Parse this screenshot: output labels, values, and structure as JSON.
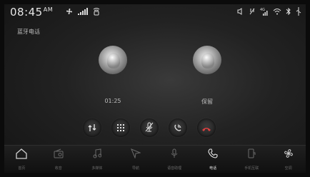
{
  "status_bar": {
    "time": "08:45",
    "ampm": "AM",
    "left_icons": [
      "fan-icon",
      "signal-icon",
      "wireless-charging-icon"
    ],
    "right_icons": [
      "volume-icon",
      "mute-icon",
      "4g-signal-icon",
      "wifi-icon",
      "bluetooth-icon",
      "usb-icon"
    ]
  },
  "page": {
    "title": "蓝牙电话"
  },
  "calls": [
    {
      "state": "01:25",
      "role": "active"
    },
    {
      "state": "保留",
      "role": "held"
    }
  ],
  "controls": [
    {
      "icon": "swap-calls-icon"
    },
    {
      "icon": "keypad-icon"
    },
    {
      "icon": "mute-mic-icon"
    },
    {
      "icon": "earpiece-icon"
    },
    {
      "icon": "hang-up-icon"
    }
  ],
  "bottom_nav": {
    "home_label": "首页",
    "items": [
      {
        "label": "收音",
        "icon": "radio-icon"
      },
      {
        "label": "多媒体",
        "icon": "music-icon"
      },
      {
        "label": "导航",
        "icon": "navigation-icon"
      },
      {
        "label": "语音助理",
        "icon": "voice-assistant-icon"
      },
      {
        "label": "电话",
        "icon": "phone-icon",
        "active": true
      },
      {
        "label": "手机互联",
        "icon": "phone-link-icon"
      },
      {
        "label": "空调",
        "icon": "climate-icon"
      }
    ]
  },
  "colors": {
    "active_nav": "#e6e6e6",
    "hang_up": "#d94040",
    "background": "#1b1b1b"
  }
}
